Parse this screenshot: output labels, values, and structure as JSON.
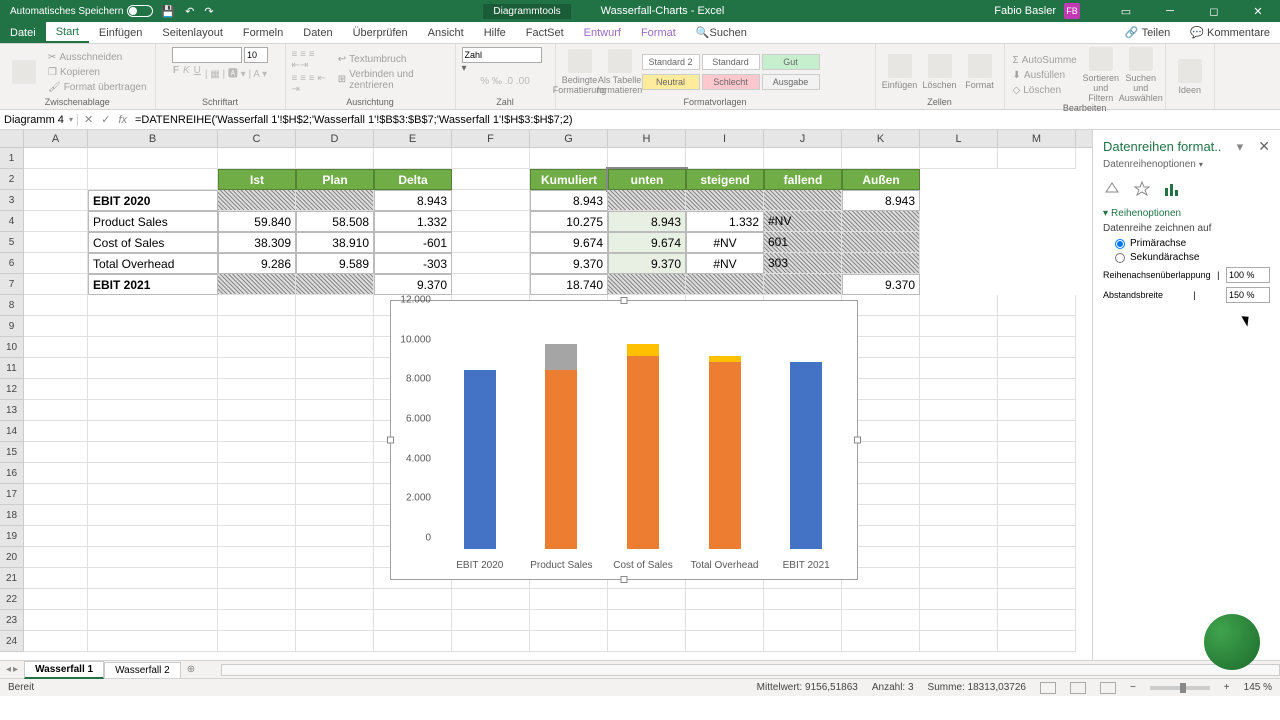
{
  "titlebar": {
    "autosave": "Automatisches Speichern",
    "toolgroup": "Diagrammtools",
    "doc": "Wasserfall-Charts - Excel",
    "user": "Fabio Basler",
    "user_initials": "FB"
  },
  "tabs": {
    "file": "Datei",
    "list": [
      "Start",
      "Einfügen",
      "Seitenlayout",
      "Formeln",
      "Daten",
      "Überprüfen",
      "Ansicht",
      "Hilfe",
      "FactSet",
      "Entwurf",
      "Format"
    ],
    "search": "Suchen",
    "share": "Teilen",
    "comments": "Kommentare"
  },
  "ribbon": {
    "clipboard": {
      "cut": "Ausschneiden",
      "copy": "Kopieren",
      "paint": "Format übertragen",
      "label": "Zwischenablage"
    },
    "font": {
      "label": "Schriftart",
      "size": "10"
    },
    "align": {
      "wrap": "Textumbruch",
      "merge": "Verbinden und zentrieren",
      "label": "Ausrichtung"
    },
    "number": {
      "format": "Zahl",
      "label": "Zahl"
    },
    "styles": {
      "cond": "Bedingte Formatierung",
      "table": "Als Tabelle formatieren",
      "s1": "Standard 2",
      "s2": "Standard",
      "s3": "Gut",
      "s4": "Neutral",
      "s5": "Schlecht",
      "s6": "Ausgabe",
      "label": "Formatvorlagen"
    },
    "cells": {
      "insert": "Einfügen",
      "delete": "Löschen",
      "format": "Format",
      "label": "Zellen"
    },
    "editing": {
      "sum": "AutoSumme",
      "fill": "Ausfüllen",
      "clear": "Löschen",
      "sort": "Sortieren und Filtern",
      "find": "Suchen und Auswählen",
      "label": "Bearbeiten"
    },
    "ideas": {
      "btn": "Ideen"
    }
  },
  "namebox": "Diagramm 4",
  "formula": "=DATENREIHE('Wasserfall 1'!$H$2;'Wasserfall 1'!$B$3:$B$7;'Wasserfall 1'!$H$3:$H$7;2)",
  "cols": [
    "A",
    "B",
    "C",
    "D",
    "E",
    "F",
    "G",
    "H",
    "I",
    "J",
    "K",
    "L",
    "M"
  ],
  "table1": {
    "headers": [
      "Ist",
      "Plan",
      "Delta"
    ],
    "rows": [
      {
        "label": "EBIT 2020",
        "ist": "",
        "plan": "",
        "delta": "8.943"
      },
      {
        "label": "Product Sales",
        "ist": "59.840",
        "plan": "58.508",
        "delta": "1.332"
      },
      {
        "label": "Cost of Sales",
        "ist": "38.309",
        "plan": "38.910",
        "delta": "-601"
      },
      {
        "label": "Total Overhead",
        "ist": "9.286",
        "plan": "9.589",
        "delta": "-303"
      },
      {
        "label": "EBIT 2021",
        "ist": "",
        "plan": "",
        "delta": "9.370"
      }
    ]
  },
  "table2": {
    "headers": [
      "Kumuliert",
      "unten",
      "steigend",
      "fallend",
      "Außen"
    ],
    "rows": [
      {
        "k": "8.943",
        "u": "",
        "s": "",
        "f": "",
        "a": "8.943"
      },
      {
        "k": "10.275",
        "u": "8.943",
        "s": "1.332",
        "f": "#NV",
        "a": ""
      },
      {
        "k": "9.674",
        "u": "9.674",
        "s": "#NV",
        "f": "601",
        "a": ""
      },
      {
        "k": "9.370",
        "u": "9.370",
        "s": "#NV",
        "f": "303",
        "a": ""
      },
      {
        "k": "18.740",
        "u": "",
        "s": "",
        "f": "",
        "a": "9.370"
      }
    ]
  },
  "chart_data": {
    "type": "bar",
    "categories": [
      "EBIT 2020",
      "Product Sales",
      "Cost of Sales",
      "Total Overhead",
      "EBIT 2021"
    ],
    "series": [
      {
        "name": "Außen",
        "values": [
          8943,
          0,
          0,
          0,
          9370
        ],
        "color": "#4472C4"
      },
      {
        "name": "unten",
        "values": [
          0,
          8943,
          9674,
          9370,
          0
        ],
        "color": "#ED7D31"
      },
      {
        "name": "steigend",
        "values": [
          0,
          1332,
          0,
          0,
          0
        ],
        "color": "#A5A5A5"
      },
      {
        "name": "fallend",
        "values": [
          0,
          0,
          601,
          303,
          0
        ],
        "color": "#FFC000"
      }
    ],
    "ylim": [
      0,
      12000
    ],
    "yticks": [
      "0",
      "2.000",
      "4.000",
      "6.000",
      "8.000",
      "10.000",
      "12.000"
    ]
  },
  "pane": {
    "title": "Datenreihen format..",
    "sub": "Datenreihenoptionen",
    "section": "Reihenoptionen",
    "drawon": "Datenreihe zeichnen auf",
    "primary": "Primärachse",
    "secondary": "Sekundärachse",
    "overlap_lbl": "Reihenachsenüberlappung",
    "overlap_val": "100 %",
    "gap_lbl": "Abstandsbreite",
    "gap_val": "150 %"
  },
  "sheets": {
    "s1": "Wasserfall 1",
    "s2": "Wasserfall 2"
  },
  "status": {
    "ready": "Bereit",
    "avg": "Mittelwert: 9156,51863",
    "count": "Anzahl: 3",
    "sum": "Summe: 18313,03726",
    "zoom": "145 %"
  }
}
